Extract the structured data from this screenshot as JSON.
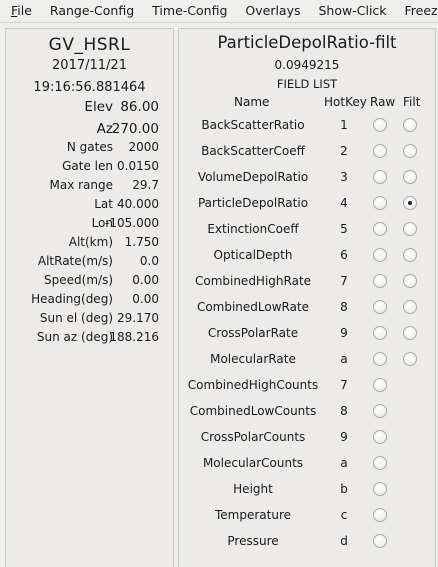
{
  "menubar": {
    "items": [
      {
        "label": "File",
        "mnemonic": "F",
        "rest": "ile"
      },
      {
        "label": "Range-Config"
      },
      {
        "label": "Time-Config"
      },
      {
        "label": "Overlays"
      },
      {
        "label": "Show-Click"
      },
      {
        "label": "Freeze"
      }
    ]
  },
  "status": {
    "title": "GV_HSRL",
    "date": "2017/11/21",
    "time": "19:16:56.881464",
    "rows": [
      {
        "label": "Elev",
        "value": "86.00"
      },
      {
        "label": "Az",
        "value": "270.00"
      },
      {
        "label": "N gates",
        "value": "2000"
      },
      {
        "label": "Gate len",
        "value": "0.0150"
      },
      {
        "label": "Max range",
        "value": "29.7"
      },
      {
        "label": "Lat",
        "value": "40.000"
      },
      {
        "label": "Lon",
        "value": "-105.000"
      },
      {
        "label": "Alt(km)",
        "value": "1.750"
      },
      {
        "label": "AltRate(m/s)",
        "value": "0.0"
      },
      {
        "label": "Speed(m/s)",
        "value": "0.00"
      },
      {
        "label": "Heading(deg)",
        "value": "0.00"
      },
      {
        "label": "Sun el (deg)",
        "value": "29.170"
      },
      {
        "label": "Sun az (deg)",
        "value": "188.216"
      }
    ]
  },
  "fields": {
    "title": "ParticleDepolRatio-filt",
    "value": "0.0949215",
    "list_header": "FIELD LIST",
    "columns": {
      "name": "Name",
      "hotkey": "HotKey",
      "raw": "Raw",
      "filt": "Filt"
    },
    "rows": [
      {
        "name": "BackScatterRatio",
        "hotkey": "1",
        "has_filt": true,
        "raw_selected": false,
        "filt_selected": false
      },
      {
        "name": "BackScatterCoeff",
        "hotkey": "2",
        "has_filt": true,
        "raw_selected": false,
        "filt_selected": false
      },
      {
        "name": "VolumeDepolRatio",
        "hotkey": "3",
        "has_filt": true,
        "raw_selected": false,
        "filt_selected": false
      },
      {
        "name": "ParticleDepolRatio",
        "hotkey": "4",
        "has_filt": true,
        "raw_selected": false,
        "filt_selected": true
      },
      {
        "name": "ExtinctionCoeff",
        "hotkey": "5",
        "has_filt": true,
        "raw_selected": false,
        "filt_selected": false
      },
      {
        "name": "OpticalDepth",
        "hotkey": "6",
        "has_filt": true,
        "raw_selected": false,
        "filt_selected": false
      },
      {
        "name": "CombinedHighRate",
        "hotkey": "7",
        "has_filt": true,
        "raw_selected": false,
        "filt_selected": false
      },
      {
        "name": "CombinedLowRate",
        "hotkey": "8",
        "has_filt": true,
        "raw_selected": false,
        "filt_selected": false
      },
      {
        "name": "CrossPolarRate",
        "hotkey": "9",
        "has_filt": true,
        "raw_selected": false,
        "filt_selected": false
      },
      {
        "name": "MolecularRate",
        "hotkey": "a",
        "has_filt": true,
        "raw_selected": false,
        "filt_selected": false
      },
      {
        "name": "CombinedHighCounts",
        "hotkey": "7",
        "has_filt": false,
        "raw_selected": false,
        "filt_selected": false
      },
      {
        "name": "CombinedLowCounts",
        "hotkey": "8",
        "has_filt": false,
        "raw_selected": false,
        "filt_selected": false
      },
      {
        "name": "CrossPolarCounts",
        "hotkey": "9",
        "has_filt": false,
        "raw_selected": false,
        "filt_selected": false
      },
      {
        "name": "MolecularCounts",
        "hotkey": "a",
        "has_filt": false,
        "raw_selected": false,
        "filt_selected": false
      },
      {
        "name": "Height",
        "hotkey": "b",
        "has_filt": false,
        "raw_selected": false,
        "filt_selected": false
      },
      {
        "name": "Temperature",
        "hotkey": "c",
        "has_filt": false,
        "raw_selected": false,
        "filt_selected": false
      },
      {
        "name": "Pressure",
        "hotkey": "d",
        "has_filt": false,
        "raw_selected": false,
        "filt_selected": false
      }
    ]
  }
}
